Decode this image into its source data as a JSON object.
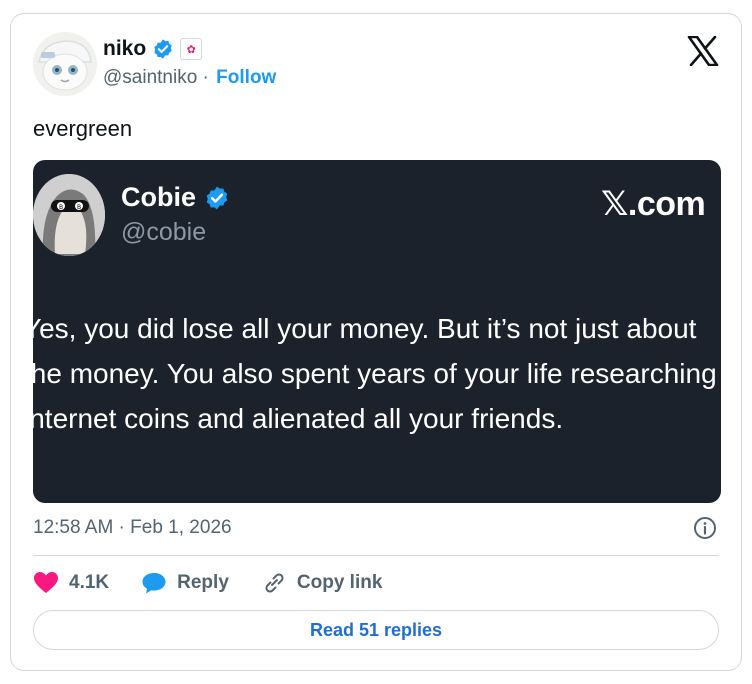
{
  "author": {
    "name": "niko",
    "handle": "@saintniko",
    "separator": " · ",
    "follow_label": "Follow",
    "avatar_icon": "cartoon-character-avatar"
  },
  "tweet": {
    "text": "evergreen",
    "timestamp": "12:58 AM · Feb 1, 2026"
  },
  "embed": {
    "name": "Cobie",
    "handle": "@cobie",
    "brand": "𝕏.com",
    "text": "Yes, you did lose all your money. But it’s not just about the money. You also spent years of your life researching internet coins and alienated all your friends.",
    "avatar_icon": "sunglasses-portrait-avatar",
    "background_color": "#1c222b"
  },
  "actions": {
    "like_count": "4.1K",
    "reply_label": "Reply",
    "copy_label": "Copy link",
    "read_replies": "Read 51 replies"
  },
  "colors": {
    "accent": "#1d9bf0",
    "like": "#f91880",
    "muted": "#536471"
  }
}
